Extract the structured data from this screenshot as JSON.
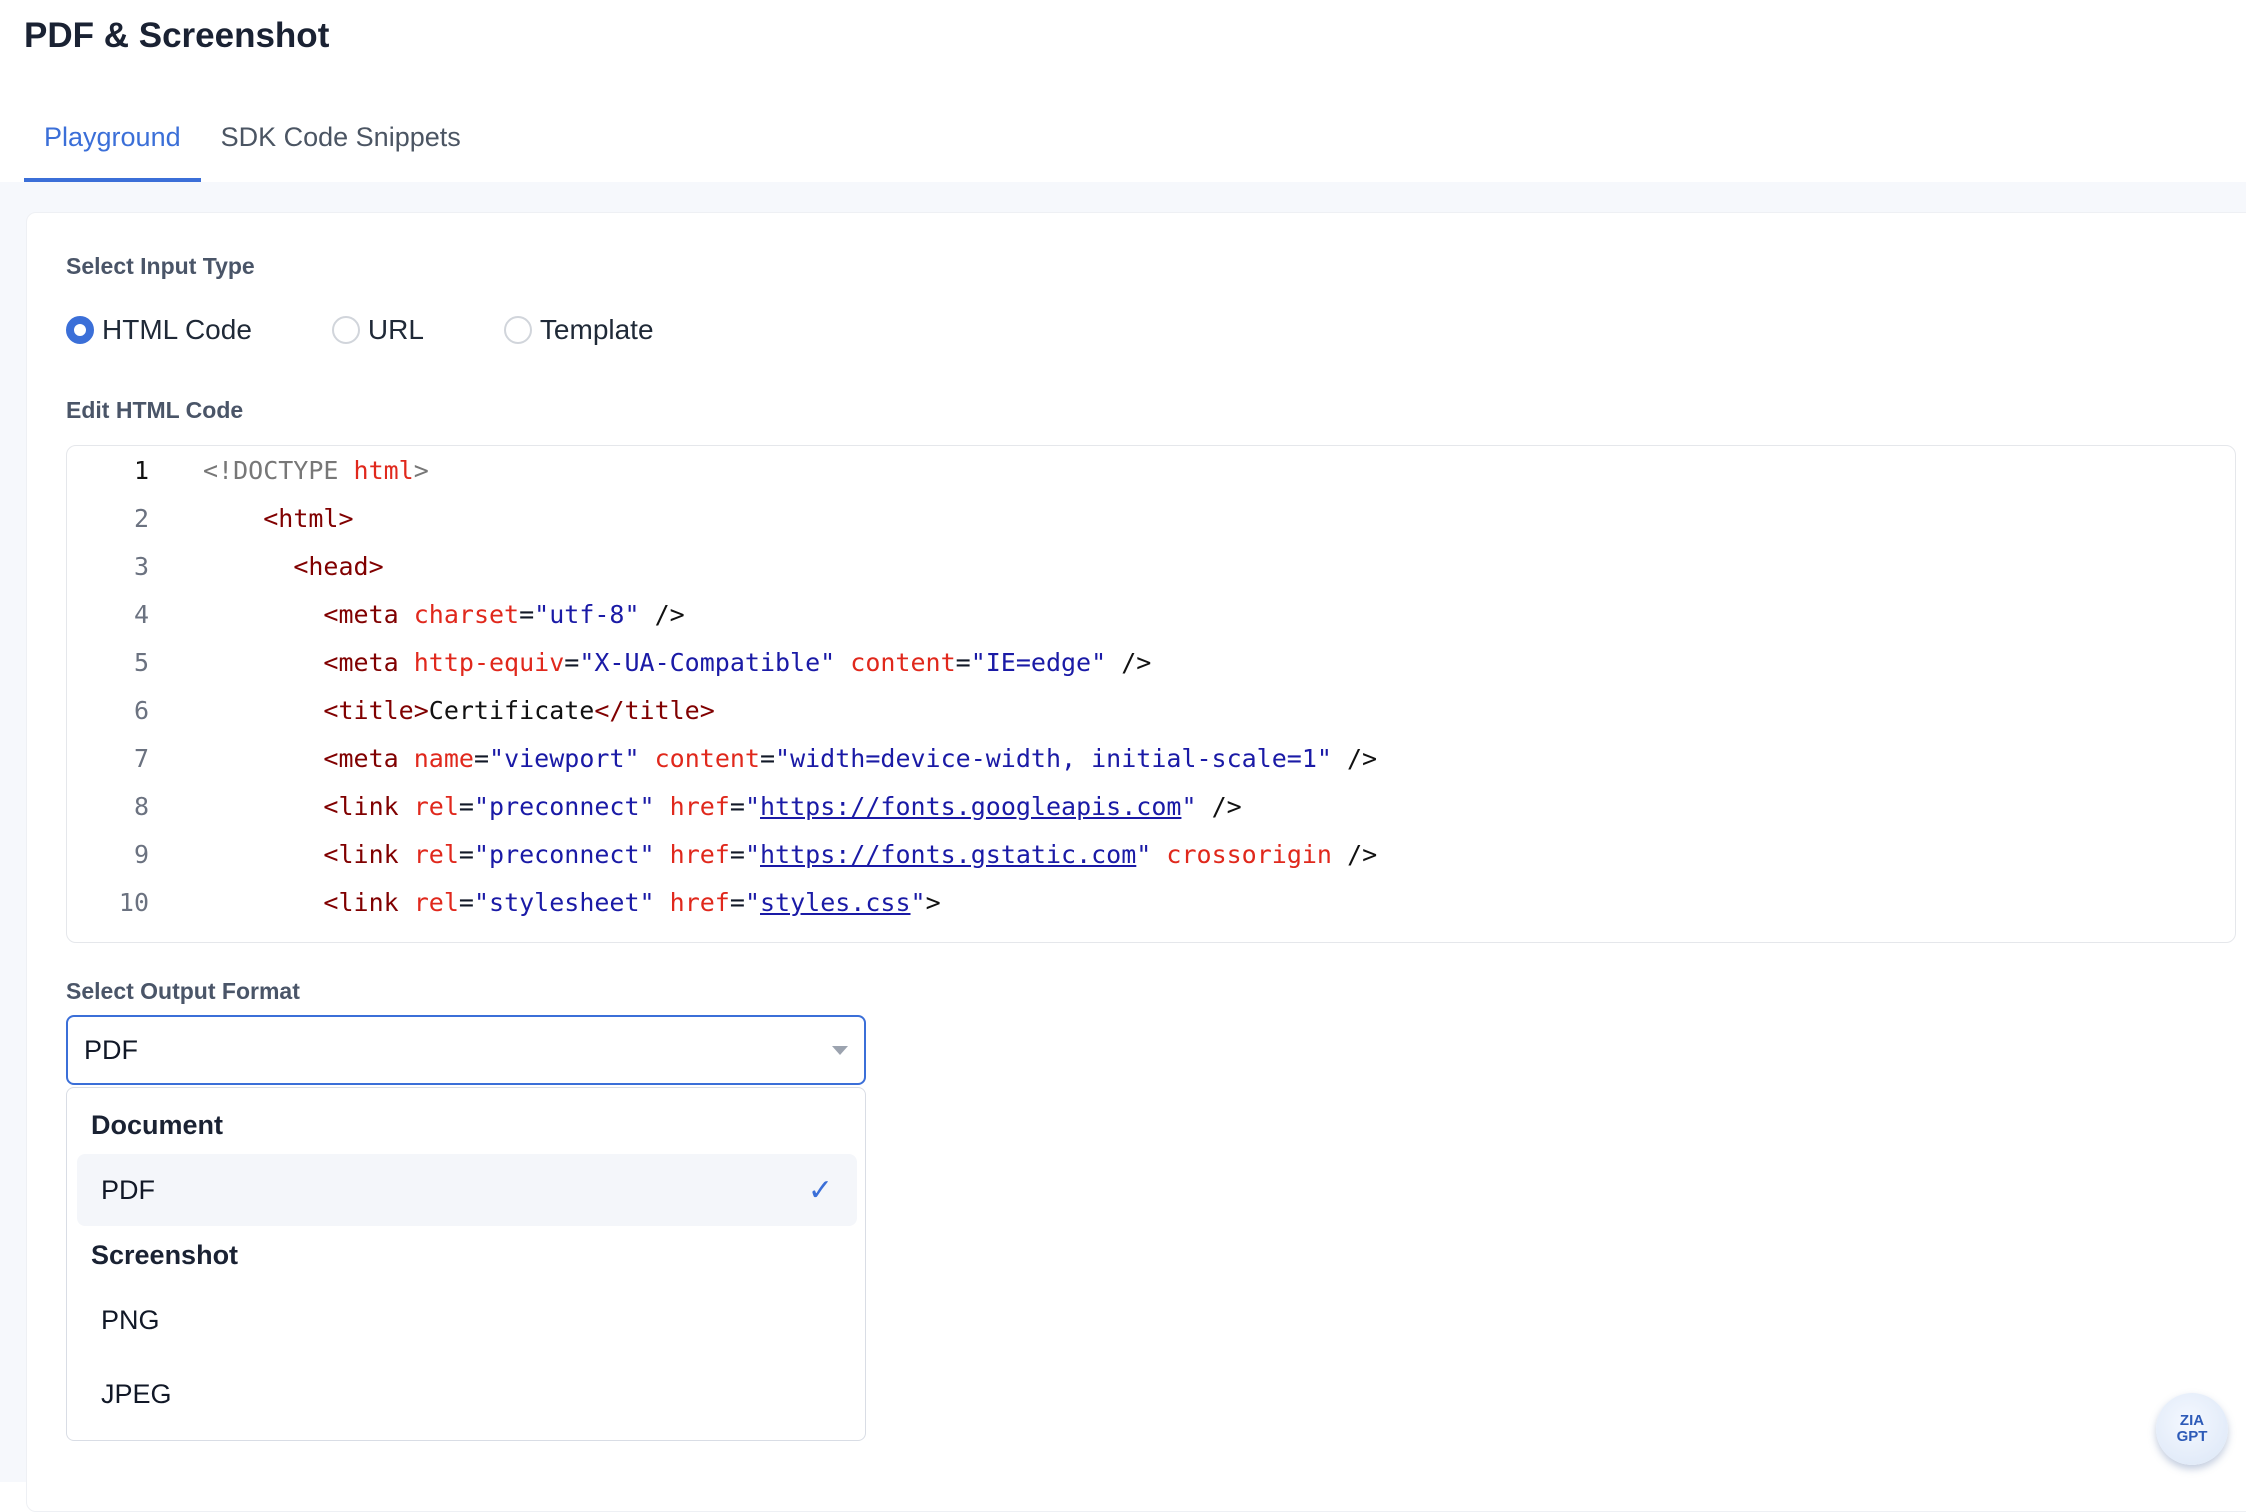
{
  "header": {
    "title": "PDF & Screenshot"
  },
  "tabs": [
    {
      "label": "Playground",
      "active": true
    },
    {
      "label": "SDK Code Snippets",
      "active": false
    }
  ],
  "input_type": {
    "label": "Select Input Type",
    "options": [
      {
        "label": "HTML Code",
        "checked": true
      },
      {
        "label": "URL",
        "checked": false
      },
      {
        "label": "Template",
        "checked": false
      }
    ]
  },
  "editor": {
    "label": "Edit HTML Code",
    "lines": [
      {
        "n": "1",
        "html": "<span class='g'>&lt;!DOCTYPE </span><span class='a'>html</span><span class='g'>&gt;</span>"
      },
      {
        "n": "2",
        "html": "    <span class='t'>&lt;html&gt;</span>"
      },
      {
        "n": "3",
        "html": "      <span class='t'>&lt;head&gt;</span>"
      },
      {
        "n": "4",
        "html": "        <span class='t'>&lt;meta</span> <span class='a'>charset</span>=<span class='v'>\"utf-8\"</span> <span class='k'>/&gt;</span>"
      },
      {
        "n": "5",
        "html": "        <span class='t'>&lt;meta</span> <span class='a'>http-equiv</span>=<span class='v'>\"X-UA-Compatible\"</span> <span class='a'>content</span>=<span class='v'>\"IE=edge\"</span> <span class='k'>/&gt;</span>"
      },
      {
        "n": "6",
        "html": "        <span class='t'>&lt;title&gt;</span><span class='k'>Certificate</span><span class='t'>&lt;/title&gt;</span>"
      },
      {
        "n": "7",
        "html": "        <span class='t'>&lt;meta</span> <span class='a'>name</span>=<span class='v'>\"viewport\"</span> <span class='a'>content</span>=<span class='v'>\"width=device-width, initial-scale=1\"</span> <span class='k'>/&gt;</span>"
      },
      {
        "n": "8",
        "html": "        <span class='t'>&lt;link</span> <span class='a'>rel</span>=<span class='v'>\"preconnect\"</span> <span class='a'>href</span>=<span class='v'>\"</span><span class='u'>https://fonts.googleapis.com</span><span class='v'>\"</span> <span class='k'>/&gt;</span>"
      },
      {
        "n": "9",
        "html": "        <span class='t'>&lt;link</span> <span class='a'>rel</span>=<span class='v'>\"preconnect\"</span> <span class='a'>href</span>=<span class='v'>\"</span><span class='u'>https://fonts.gstatic.com</span><span class='v'>\"</span> <span class='a'>crossorigin</span> <span class='k'>/&gt;</span>"
      },
      {
        "n": "10",
        "html": "        <span class='t'>&lt;link</span> <span class='a'>rel</span>=<span class='v'>\"stylesheet\"</span> <span class='a'>href</span>=<span class='v'>\"</span><span class='u'>styles.css</span><span class='v'>\"</span><span class='k'>&gt;</span>"
      }
    ]
  },
  "output": {
    "label": "Select Output Format",
    "selected": "PDF",
    "groups": [
      {
        "label": "Document",
        "options": [
          "PDF"
        ]
      },
      {
        "label": "Screenshot",
        "options": [
          "PNG",
          "JPEG"
        ]
      }
    ]
  },
  "assistant": {
    "label": "ZIA GPT",
    "icon": "zia-assistant-icon"
  },
  "colors": {
    "accent": "#3b6fd8"
  }
}
